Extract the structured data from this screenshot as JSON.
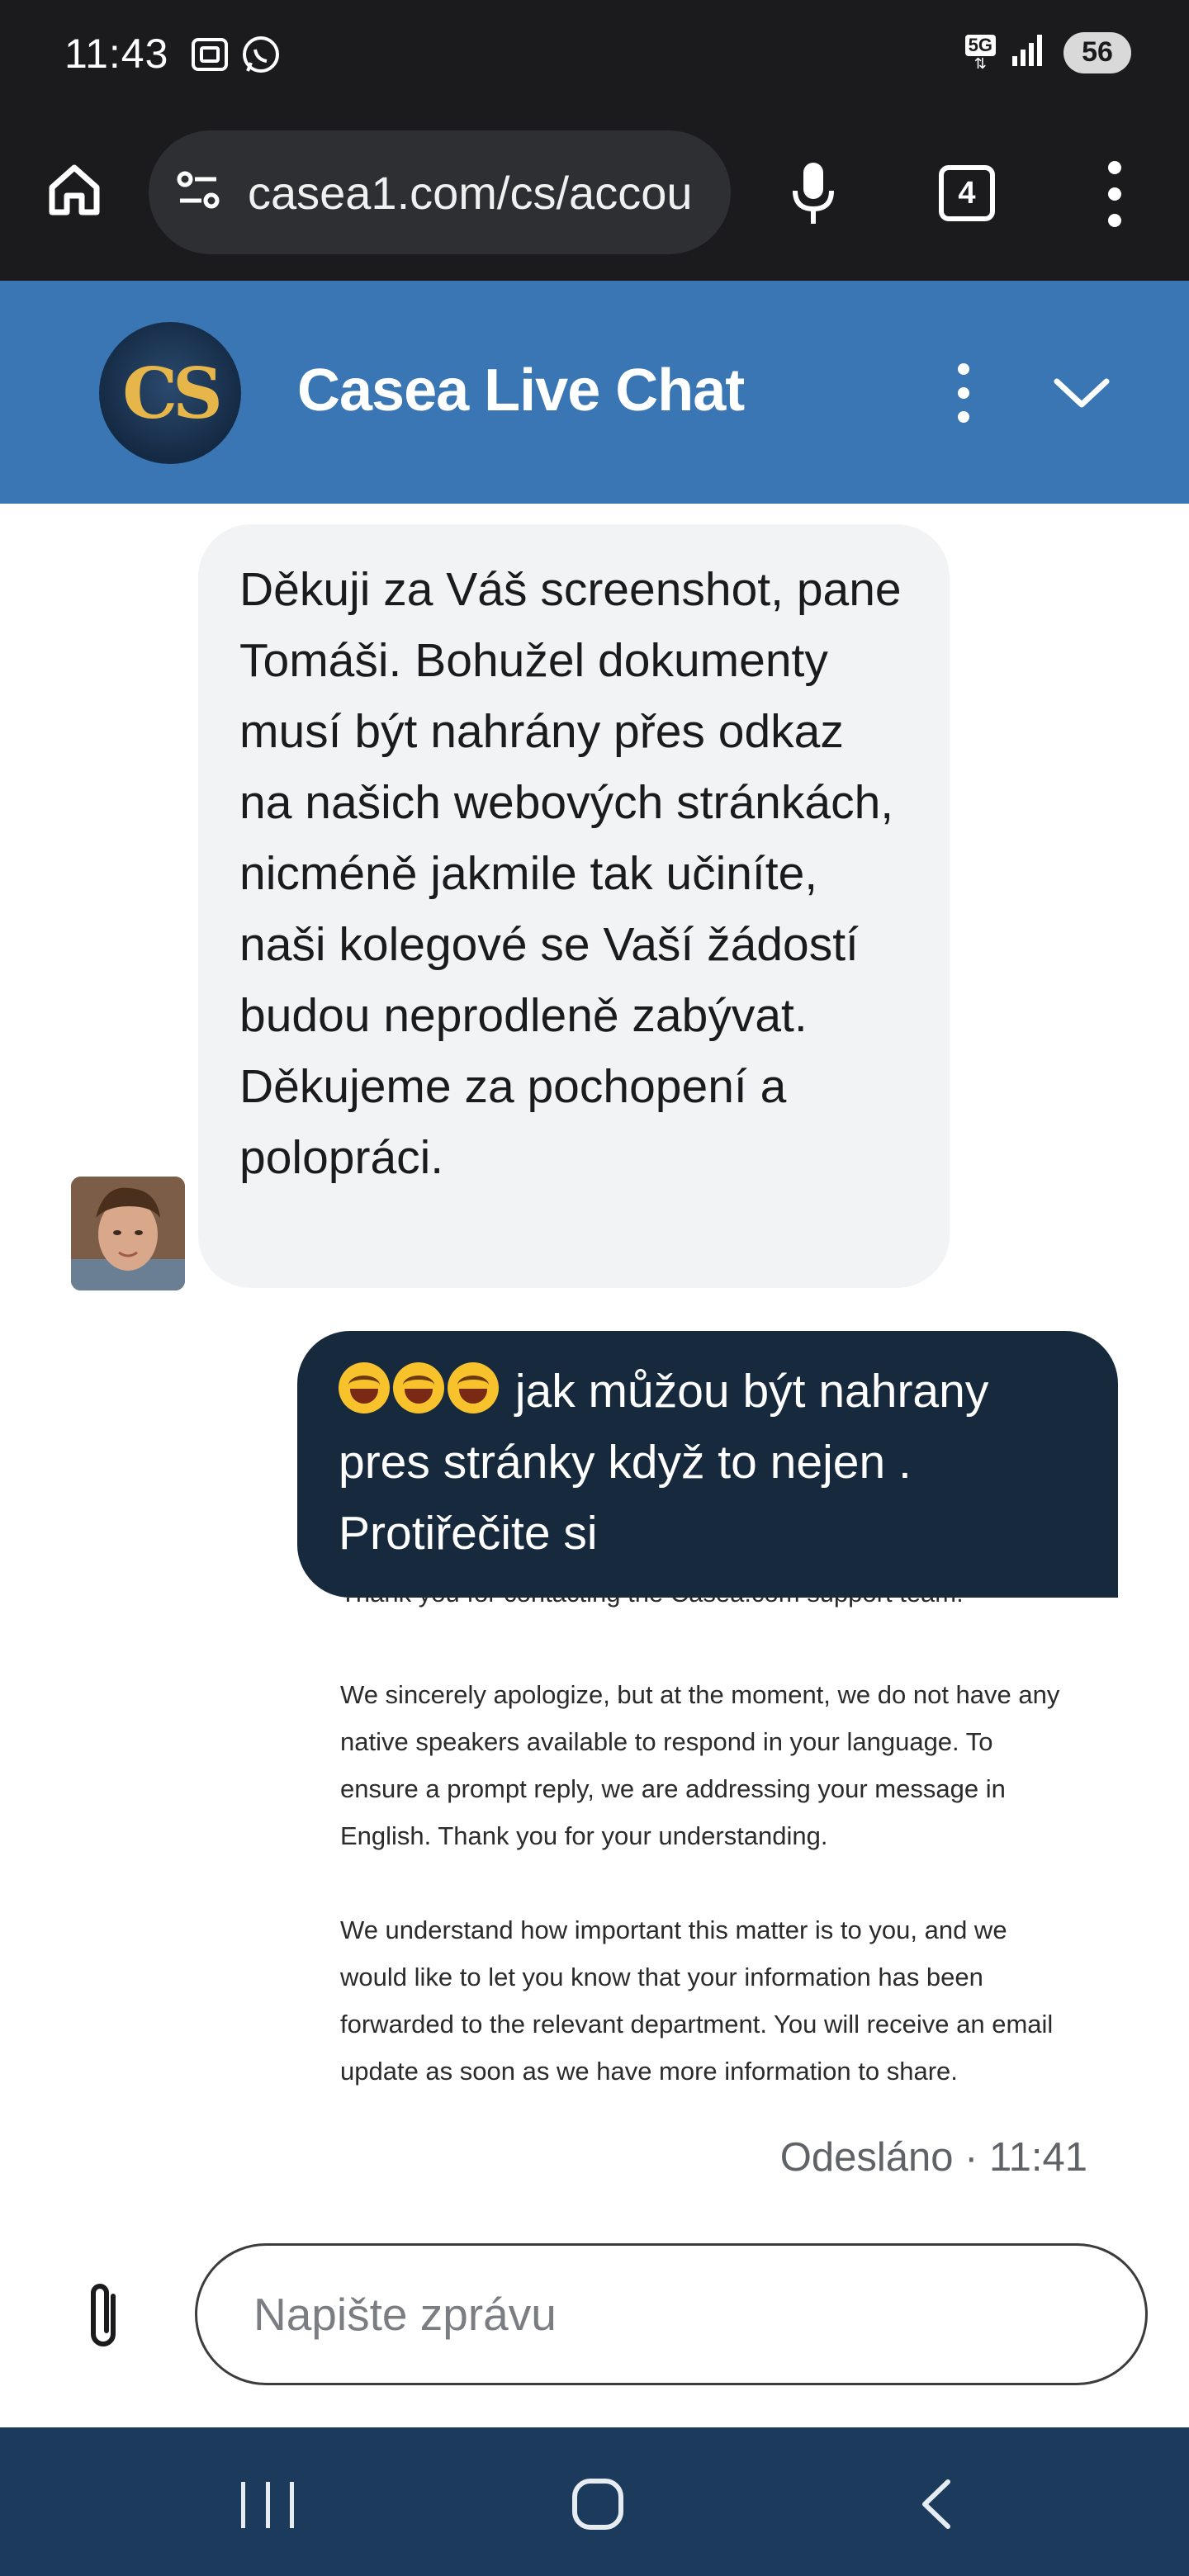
{
  "status_bar": {
    "time": "11:43",
    "network": "5G",
    "battery": "56"
  },
  "browser": {
    "url": "casea1.com/cs/accou",
    "tab_count": "4",
    "icons": [
      "home-icon",
      "site-settings-icon",
      "mic-icon",
      "tabs-icon",
      "more-vert-icon"
    ]
  },
  "chat_header": {
    "logo_text": "CS",
    "title": "Casea Live Chat"
  },
  "messages": {
    "incoming_text": "Děkuji za Váš screenshot, pane Tomáši. Bohužel dokumenty musí být nahrány přes odkaz na našich webových stránkách, nicméně jakmile tak učiníte, naši kolegové se Vaší žádostí budou neprodleně zabývat. Děkujeme za pochopení a polopráci.",
    "outgoing_text": "jak můžou být nahrany pres stránky když to nejen  . Protiřečite si",
    "outgoing_emoji_count": 3,
    "quoted_first_line": "Thank you for contacting the Casea.com support team.",
    "quoted_para_1": "We sincerely apologize, but at the moment, we do not have any native speakers available to respond in your language. To ensure a prompt reply, we are addressing your message in English. Thank you for your understanding.",
    "quoted_para_2": "We understand how important this matter is to you, and we would like to let you know that your information has been forwarded to the relevant department. You will receive an email update as soon as we have more information to share.",
    "sent_status": "Odesláno · 11:41"
  },
  "composer": {
    "placeholder": "Napište zprávu"
  },
  "colors": {
    "header_bg": "#3a76b4",
    "outgoing_bubble": "#172a3d",
    "incoming_bubble": "#f2f3f5",
    "nav_bg": "#1c3a5b",
    "browser_bg": "#1b1b1d"
  }
}
